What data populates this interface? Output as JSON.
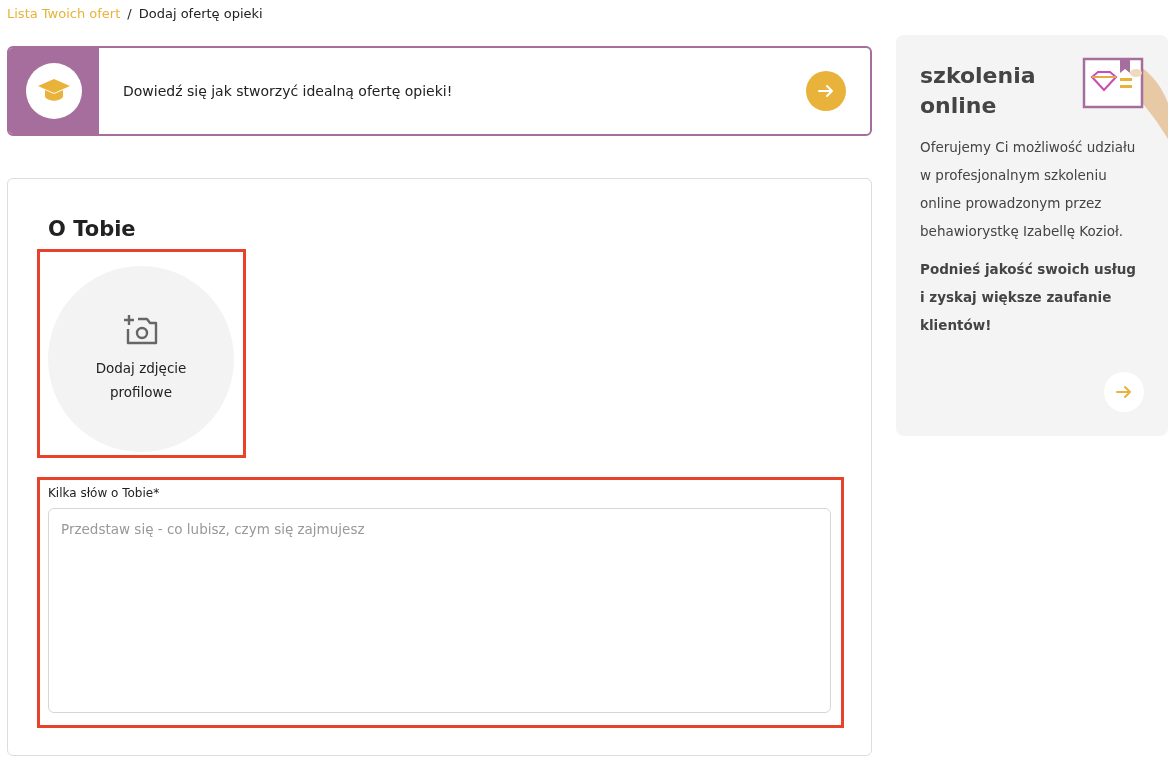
{
  "breadcrumb": [
    {
      "label": "Lista Twoich ofert",
      "kind": "link"
    },
    {
      "label": "/",
      "kind": "separator"
    },
    {
      "label": "Dodaj ofertę opieki",
      "kind": "current"
    }
  ],
  "banner": {
    "text": "Dowiedź się jak stworzyć idealną ofertę opieki!"
  },
  "form": {
    "section_title": "O Tobie",
    "photo_upload": {
      "label": "Dodaj zdjęcie profilowe",
      "highlighted": true
    },
    "about": {
      "label": "Kilka słów o Tobie*",
      "placeholder": "Przedstaw się - co lubisz, czym się zajmujesz",
      "highlighted": true
    }
  },
  "promo": {
    "title": "szkolenia online",
    "text": "Oferujemy Ci możliwość udziału w profesjonalnym szkoleniu online prowadzonym przez behawiorystkę Izabellę Kozioł.",
    "highlight": "Podnieś jakość swoich usług i zyskaj większe zaufanie klientów!"
  }
}
